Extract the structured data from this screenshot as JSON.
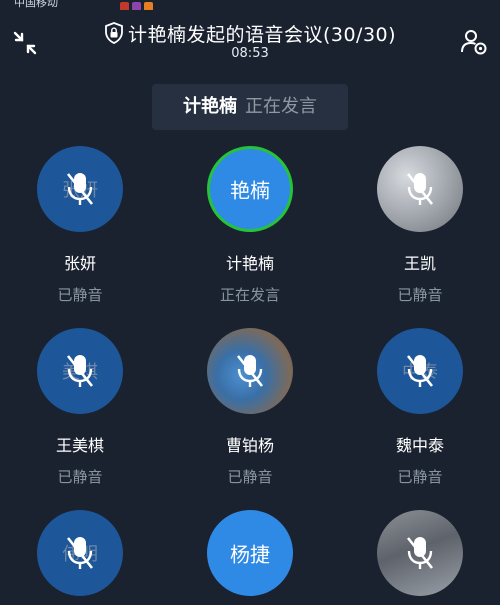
{
  "status_bar": {
    "carrier": "中国移动"
  },
  "header": {
    "title": "计艳楠发起的语音会议(30/30)",
    "timer": "08:53"
  },
  "banner": {
    "speaker": "计艳楠",
    "state": "正在发言"
  },
  "participants": [
    {
      "name": "张妍",
      "avatar_text": "张妍",
      "status": "已静音",
      "muted": true
    },
    {
      "name": "计艳楠",
      "avatar_text": "艳楠",
      "status": "正在发言",
      "muted": false
    },
    {
      "name": "王凯",
      "avatar_text": "",
      "status": "已静音",
      "muted": true
    },
    {
      "name": "王美棋",
      "avatar_text": "美棋",
      "status": "已静音",
      "muted": true
    },
    {
      "name": "曹铂杨",
      "avatar_text": "",
      "status": "已静音",
      "muted": true
    },
    {
      "name": "魏中泰",
      "avatar_text": "中泰",
      "status": "已静音",
      "muted": true
    },
    {
      "name": "",
      "avatar_text": "伟明",
      "status": "",
      "muted": true
    },
    {
      "name": "",
      "avatar_text": "杨捷",
      "status": "",
      "muted": false
    },
    {
      "name": "",
      "avatar_text": "",
      "status": "",
      "muted": true
    }
  ],
  "colors": {
    "background": "#1a2230",
    "avatar_dark": "#1d5699",
    "avatar_blue": "#2f8ae6",
    "speaking_ring": "#25c23a",
    "muted_text": "#8a94a1"
  }
}
